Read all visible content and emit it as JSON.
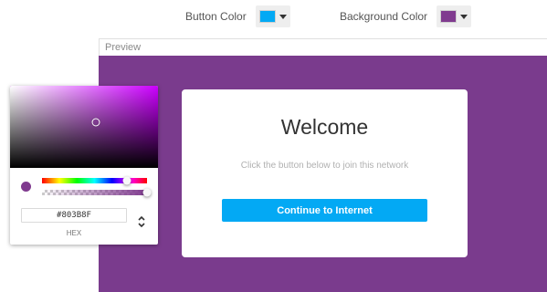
{
  "toolbar": {
    "button_color_label": "Button Color",
    "background_color_label": "Background Color",
    "button_color": "#03A9F4",
    "background_color": "#803B8F"
  },
  "preview": {
    "header_label": "Preview",
    "background": "#7A3B8D",
    "card": {
      "title": "Welcome",
      "subtitle": "Click the button below to join this network",
      "button_label": "Continue to Internet",
      "button_color": "#03A9F4"
    }
  },
  "color_picker": {
    "hex_value": "#803B8F",
    "mode_label": "HEX",
    "hue_color": "#CC00FF",
    "current_color": "#803B8F",
    "hue_position": 0.81,
    "alpha_position": 1.0,
    "saturation_position": {
      "s": 0.58,
      "v": 0.56
    },
    "icons": [
      "arrow-up-down-icon",
      "caret-down-icon"
    ]
  }
}
